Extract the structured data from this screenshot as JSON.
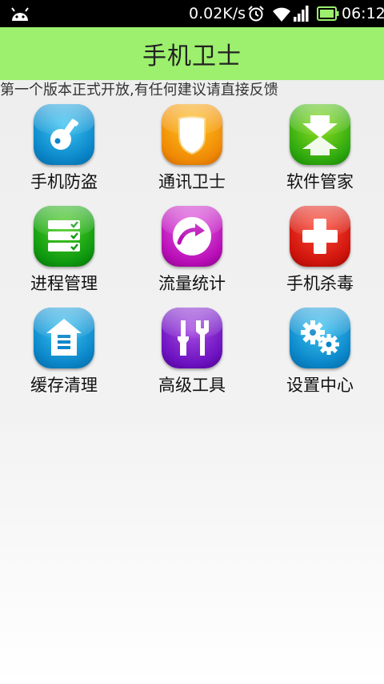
{
  "status_bar": {
    "net_speed": "0.02K/s",
    "time": "06:12",
    "icons": [
      "android-icon",
      "alarm-icon",
      "wifi-icon",
      "signal-icon",
      "battery-icon"
    ]
  },
  "app": {
    "title": "手机卫士",
    "notice": "第一个版本正式开放,有任何建议请直接反馈",
    "accent_color": "#9df06e"
  },
  "grid": {
    "items": [
      {
        "label": "手机防盗",
        "icon": "key-icon",
        "color": "#0a86c9"
      },
      {
        "label": "通讯卫士",
        "icon": "shield-icon",
        "color": "#f08b06"
      },
      {
        "label": "软件管家",
        "icon": "download-upload-icon",
        "color": "#2fa90f"
      },
      {
        "label": "进程管理",
        "icon": "process-list-icon",
        "color": "#0f9a10"
      },
      {
        "label": "流量统计",
        "icon": "traffic-arrow-icon",
        "color": "#b90fb8"
      },
      {
        "label": "手机杀毒",
        "icon": "medical-cross-icon",
        "color": "#d0150d"
      },
      {
        "label": "缓存清理",
        "icon": "cache-clean-icon",
        "color": "#0a86c9"
      },
      {
        "label": "高级工具",
        "icon": "tools-icon",
        "color": "#6d12c0"
      },
      {
        "label": "设置中心",
        "icon": "gears-icon",
        "color": "#0a86c9"
      }
    ]
  }
}
